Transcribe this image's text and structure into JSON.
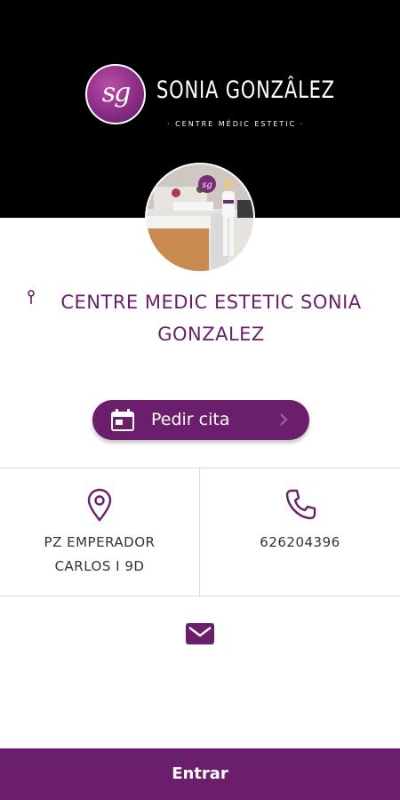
{
  "brand": {
    "monogram": "sg",
    "name": "SONIA GONZÂLEZ",
    "tagline": "· CENTRE MÉDIC ESTETIC ·"
  },
  "business": {
    "name": "CENTRE MEDIC ESTETIC SONIA GONZALEZ"
  },
  "appointment": {
    "label": "Pedir cita"
  },
  "contact": {
    "address": "PZ EMPERADOR CARLOS I 9D",
    "phone": "626204396"
  },
  "footer": {
    "enter_label": "Entrar"
  },
  "icons": {
    "location": "map-pin-icon",
    "phone": "phone-icon",
    "email": "email-icon",
    "calendar": "calendar-icon",
    "chevron": "chevron-right-icon"
  },
  "colors": {
    "accent": "#6b1e6b",
    "header_bg": "#000000"
  }
}
